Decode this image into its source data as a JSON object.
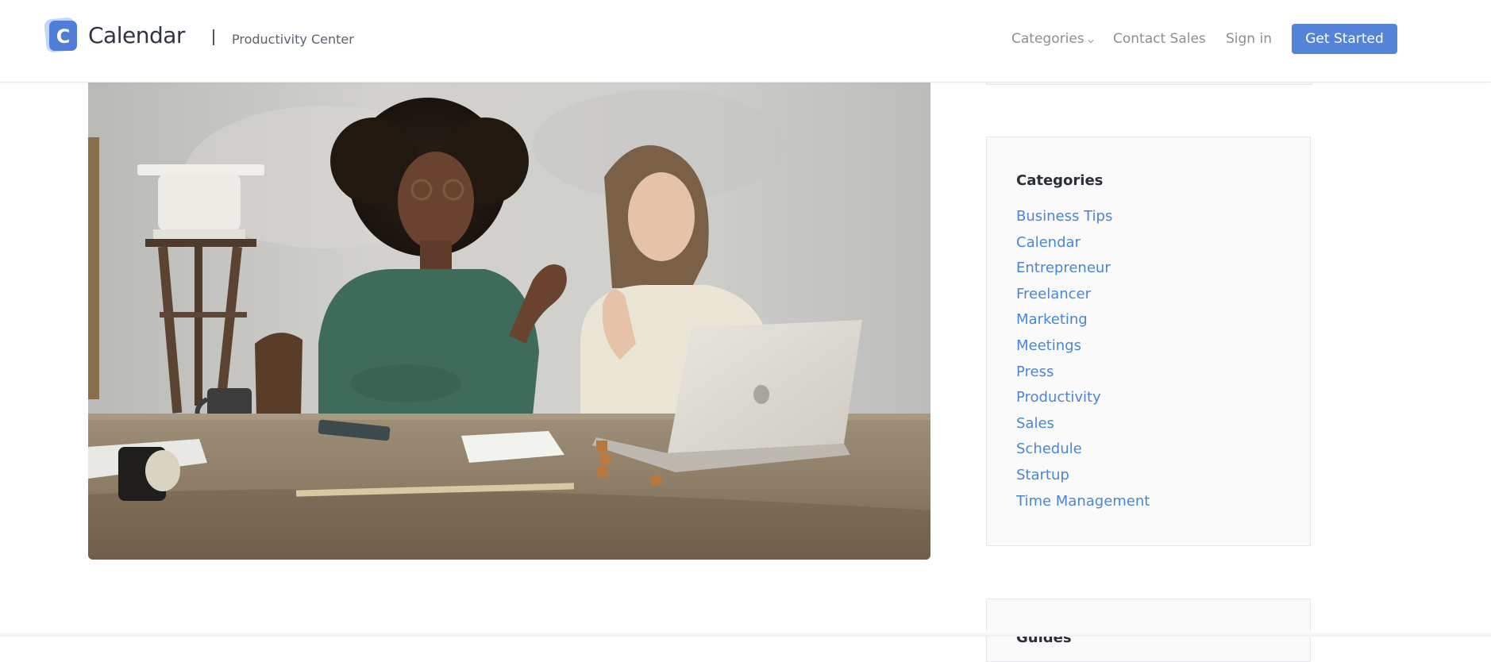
{
  "header": {
    "logo_letter": "C",
    "logo_text": "Calendar",
    "subtitle": "Productivity Center",
    "nav": {
      "categories_label": "Categories",
      "contact_label": "Contact Sales",
      "signin_label": "Sign in",
      "cta_label": "Get Started"
    },
    "brand_color": "#5583d7"
  },
  "hero": {
    "icons": [
      "laptop",
      "people",
      "mug",
      "phone"
    ]
  },
  "sidebar": {
    "categories_title": "Categories",
    "categories": [
      "Business Tips",
      "Calendar",
      "Entrepreneur",
      "Freelancer",
      "Marketing",
      "Meetings",
      "Press",
      "Productivity",
      "Sales",
      "Schedule",
      "Startup",
      "Time Management"
    ],
    "link_color": "#4a86d6",
    "next_box_title": "Guides"
  }
}
